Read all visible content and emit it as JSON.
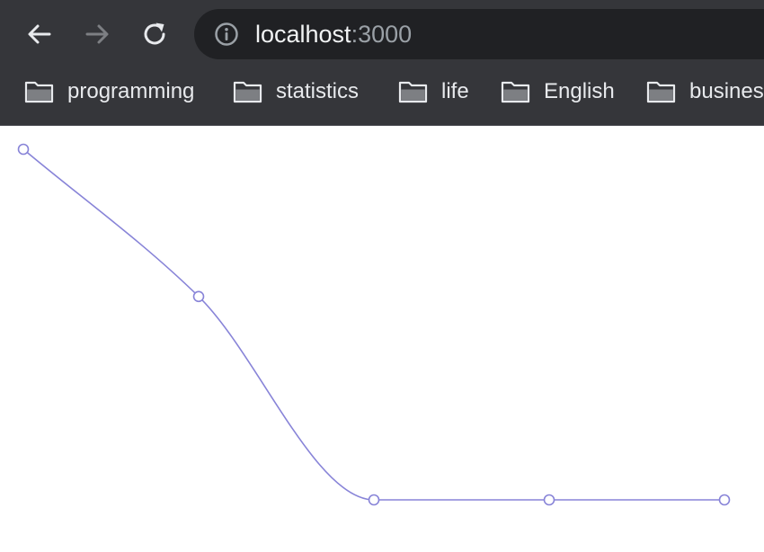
{
  "browser": {
    "url_host": "localhost",
    "url_port": ":3000",
    "bookmarks": [
      {
        "label": "programming",
        "icon": "folder-icon"
      },
      {
        "label": "statistics",
        "icon": "folder-icon"
      },
      {
        "label": "life",
        "icon": "folder-icon"
      },
      {
        "label": "English",
        "icon": "folder-icon"
      },
      {
        "label": "business",
        "icon": "folder-icon"
      }
    ],
    "colors": {
      "chrome_bg": "#35363a",
      "omnibox_bg": "#202124",
      "text": "#e8eaed",
      "muted_text": "#9aa0a6"
    }
  },
  "chart_data": {
    "type": "line",
    "curve": "monotone",
    "x": [
      0,
      1,
      2,
      3,
      4
    ],
    "values": [
      100,
      58,
      0,
      0,
      0
    ],
    "ylim": [
      0,
      100
    ],
    "grid": false,
    "legend": "none",
    "stroke_color": "#8884d8",
    "dot_fill": "#ffffff"
  }
}
